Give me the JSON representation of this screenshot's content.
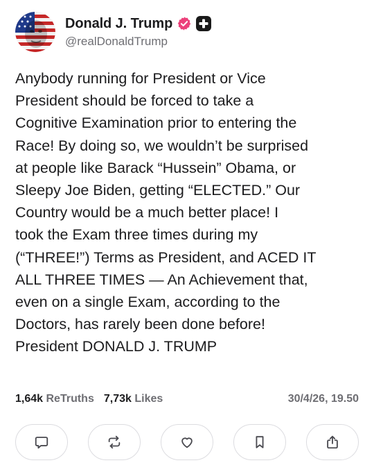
{
  "author": {
    "display_name": "Donald J. Trump",
    "handle": "@realDonaldTrump",
    "avatar": "portrait-with-us-flag-face-paint",
    "verified_icon": "verified-badge-icon",
    "verified_color": "#ec407a",
    "badge_icon": "plus-badge-icon"
  },
  "post": {
    "text": "Anybody running for President or Vice\nPresident should be forced to take a\nCognitive Examination prior to entering the\nRace! By doing so, we wouldn’t be surprised\nat people like Barack “Hussein” Obama, or\nSleepy Joe Biden, getting “ELECTED.” Our\nCountry would be a much better place! I\ntook the Exam three times during my\n(“THREE!”) Terms as President, and ACED IT\nALL THREE TIMES — An Achievement that,\neven on a single Exam, according to the\nDoctors, has rarely been done before!\nPresident DONALD J. TRUMP"
  },
  "stats": {
    "retruths_count": "1,64k",
    "retruths_label": "ReTruths",
    "likes_count": "7,73k",
    "likes_label": "Likes",
    "timestamp": "30/4/26, 19.50"
  },
  "actions": [
    {
      "icon": "comment-icon"
    },
    {
      "icon": "retruth-icon"
    },
    {
      "icon": "heart-icon"
    },
    {
      "icon": "bookmark-icon"
    },
    {
      "icon": "share-icon"
    }
  ],
  "colors": {
    "text": "#1c1c1e",
    "secondary": "#6e6e73",
    "border": "#dcdce0",
    "icon": "#4a4a50"
  }
}
